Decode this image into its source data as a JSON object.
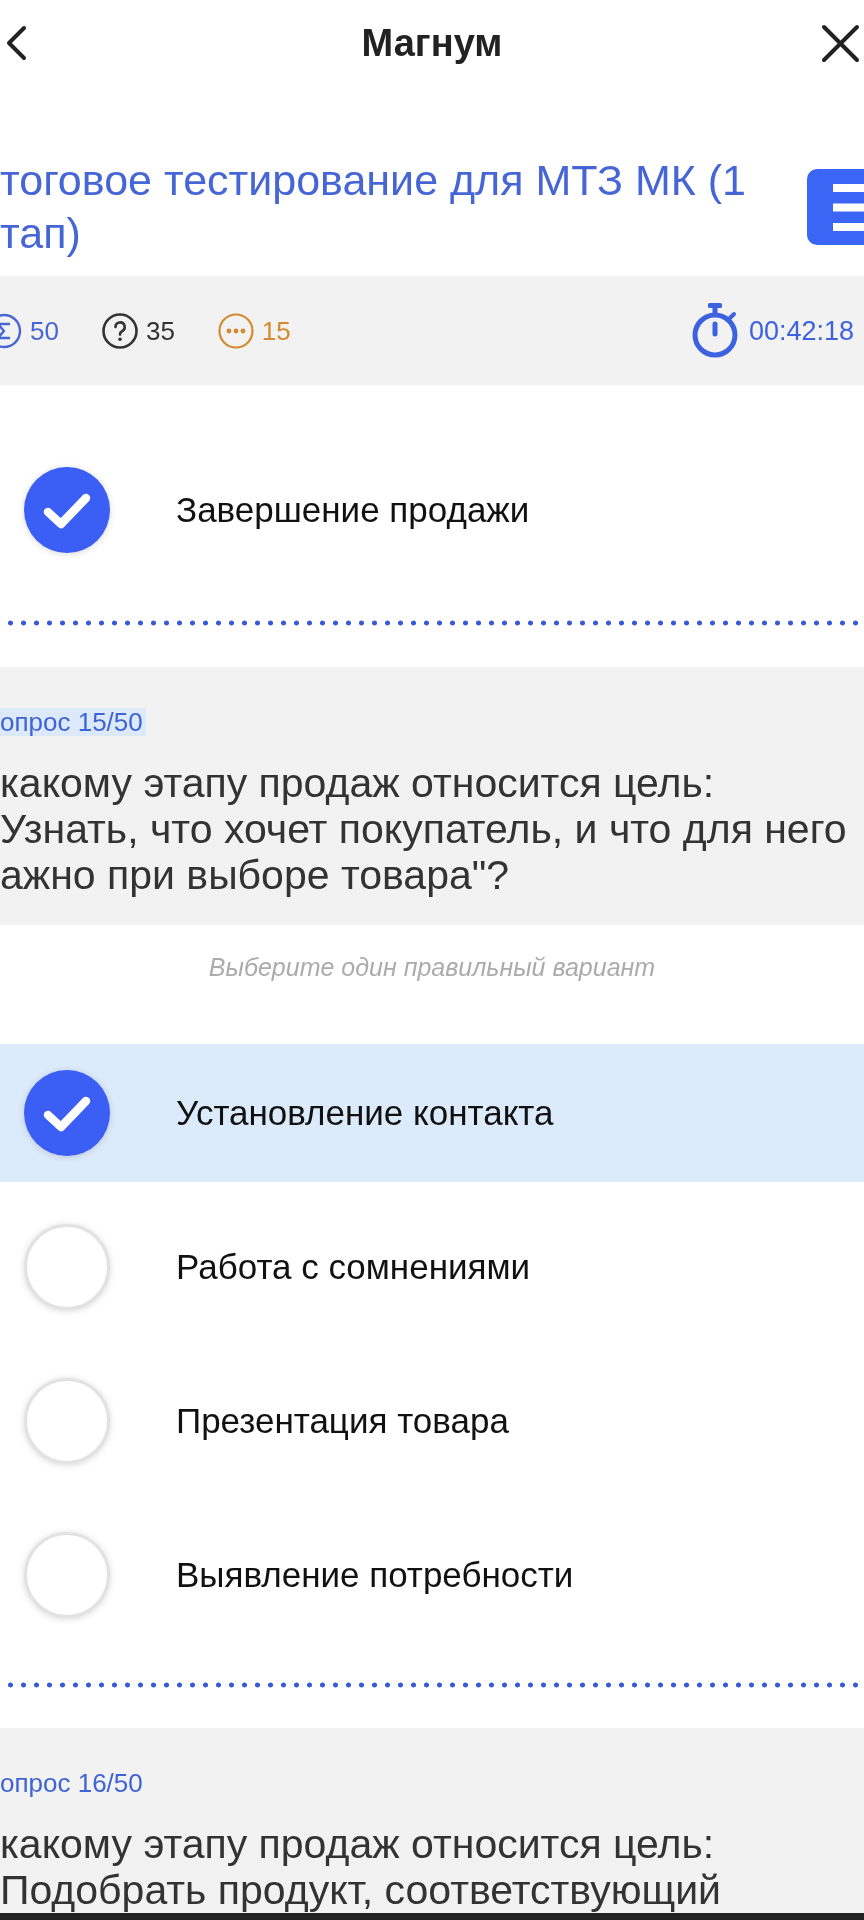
{
  "header": {
    "title": "Магнум"
  },
  "test": {
    "title_lines": [
      "тоговое тестирование для МТЗ МК (1",
      "тап)"
    ]
  },
  "stats": [
    {
      "kind": "total",
      "value": "50"
    },
    {
      "kind": "unanswered",
      "value": "35"
    },
    {
      "kind": "pending",
      "value": "15"
    }
  ],
  "timer": {
    "value": "00:42:18"
  },
  "questions": [
    {
      "current": false,
      "options": [
        {
          "text": "Завершение продажи",
          "selected": true
        }
      ]
    },
    {
      "current": true,
      "label": "опрос 15/50",
      "lines": [
        "какому этапу продаж относится цель:",
        "Узнать, что хочет покупатель, и что для него",
        "ажно при выборе товара\"?"
      ],
      "hint": "Выберите один правильный вариант",
      "options": [
        {
          "text": "Установление контакта",
          "selected": true
        },
        {
          "text": "Работа с сомнениями",
          "selected": false
        },
        {
          "text": "Презентация товара",
          "selected": false
        },
        {
          "text": "Выявление потребности",
          "selected": false
        }
      ]
    },
    {
      "current": false,
      "label": "опрос 16/50",
      "lines": [
        "какому этапу продаж относится цель:",
        "Подобрать продукт, соответствующий"
      ]
    }
  ]
}
